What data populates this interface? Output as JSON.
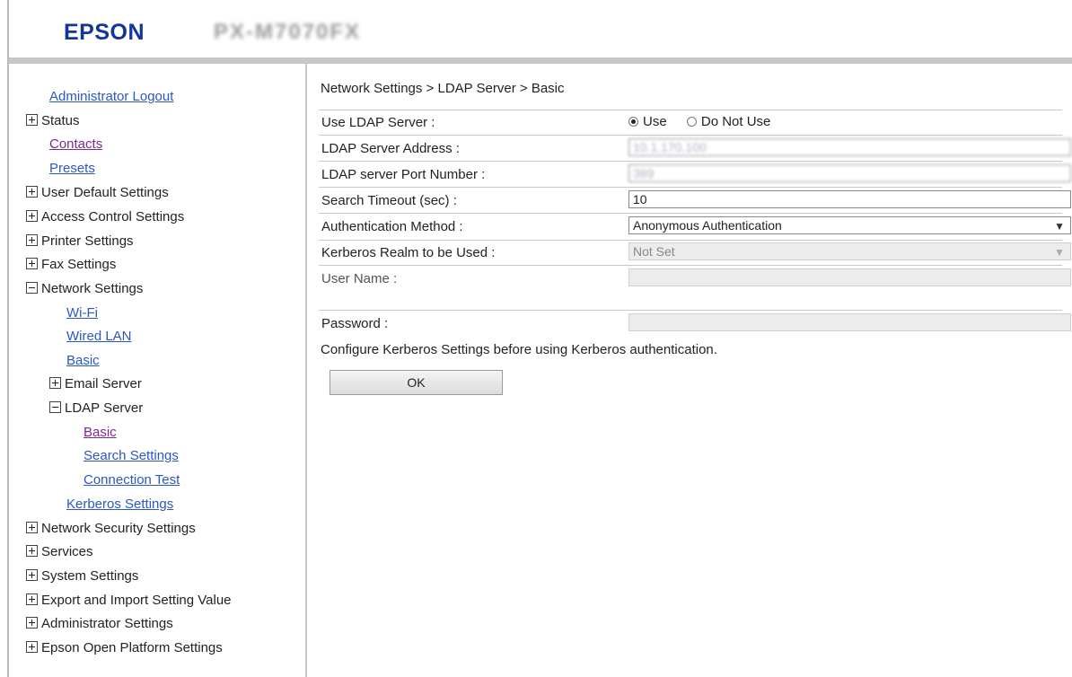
{
  "header": {
    "brand": "EPSON",
    "model": "PX-M7070FX"
  },
  "sidebar": {
    "logout": "Administrator Logout",
    "status": "Status",
    "contacts": "Contacts",
    "presets": "Presets",
    "user_default": "User Default Settings",
    "access_control": "Access Control Settings",
    "printer": "Printer Settings",
    "fax": "Fax Settings",
    "network": "Network Settings",
    "wifi": "Wi-Fi",
    "wired_lan": "Wired LAN",
    "basic": "Basic",
    "email_server": "Email Server",
    "ldap_server": "LDAP Server",
    "ldap_basic": "Basic",
    "search_settings": "Search Settings",
    "connection_test": "Connection Test",
    "kerberos": "Kerberos Settings",
    "network_security": "Network Security Settings",
    "services": "Services",
    "system": "System Settings",
    "export_import": "Export and Import Setting Value",
    "administrator": "Administrator Settings",
    "open_platform": "Epson Open Platform Settings"
  },
  "main": {
    "breadcrumb": "Network Settings > LDAP Server > Basic",
    "use_ldap": {
      "label": "Use LDAP Server :",
      "options": [
        "Use",
        "Do Not Use"
      ],
      "selected": "Use"
    },
    "server_address": {
      "label": "LDAP Server Address :",
      "value": "10.1.170.100"
    },
    "port_number": {
      "label": "LDAP server Port Number :",
      "value": "389"
    },
    "search_timeout": {
      "label": "Search Timeout (sec) :",
      "value": "10"
    },
    "auth_method": {
      "label": "Authentication Method :",
      "value": "Anonymous Authentication"
    },
    "kerberos_realm": {
      "label": "Kerberos Realm to be Used :",
      "value": "Not Set"
    },
    "user_name": {
      "label": "User Name :",
      "value": ""
    },
    "password": {
      "label": "Password :",
      "value": ""
    },
    "note": "Configure Kerberos Settings before using Kerberos authentication.",
    "ok_label": "OK"
  },
  "colors": {
    "brand": "#12359a",
    "link": "#2a58c3",
    "visited": "#7a2a8f",
    "band": "#c7c7c7"
  }
}
